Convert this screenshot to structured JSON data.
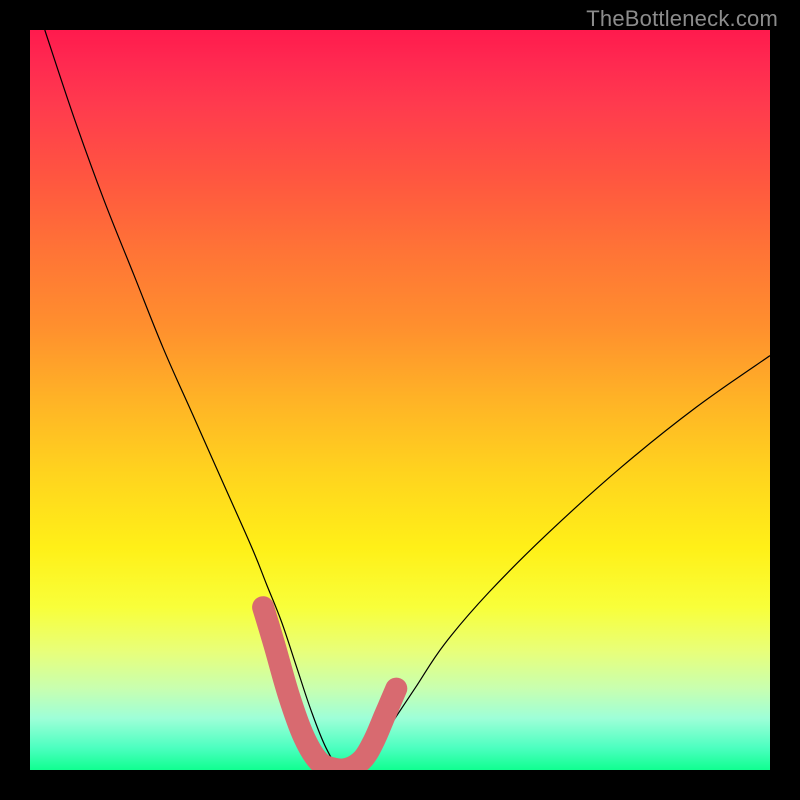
{
  "watermark": "TheBottleneck.com",
  "chart_data": {
    "type": "line",
    "title": "",
    "xlabel": "",
    "ylabel": "",
    "xlim": [
      0,
      100
    ],
    "ylim": [
      0,
      100
    ],
    "legend": false,
    "grid": false,
    "background_gradient": {
      "direction": "top-to-bottom",
      "stops": [
        {
          "pos": 0,
          "color": "#ff1a4d"
        },
        {
          "pos": 50,
          "color": "#ffb326"
        },
        {
          "pos": 80,
          "color": "#f8ff3a"
        },
        {
          "pos": 100,
          "color": "#10ff90"
        }
      ]
    },
    "series": [
      {
        "name": "bottleneck-curve",
        "color": "#000000",
        "stroke_width": 1.2,
        "x": [
          2,
          6,
          10,
          14,
          18,
          22,
          26,
          30,
          32,
          34,
          36,
          38,
          40,
          42,
          44,
          46,
          48,
          52,
          56,
          62,
          70,
          80,
          90,
          100
        ],
        "y": [
          100,
          88,
          77,
          67,
          57,
          48,
          39,
          30,
          25,
          20,
          14,
          8,
          3,
          0,
          0,
          2,
          5,
          11,
          17,
          24,
          32,
          41,
          49,
          56
        ]
      },
      {
        "name": "highlight-band",
        "color": "#d86a70",
        "stroke_width": 12,
        "stroke_linecap": "round",
        "x": [
          31.5,
          33,
          35,
          37,
          39,
          41,
          43,
          45,
          46.5,
          48.0,
          49.5
        ],
        "y": [
          22,
          17,
          10,
          4.5,
          1.2,
          0.2,
          0.2,
          1.5,
          4,
          7.5,
          11
        ]
      }
    ],
    "annotations": []
  }
}
